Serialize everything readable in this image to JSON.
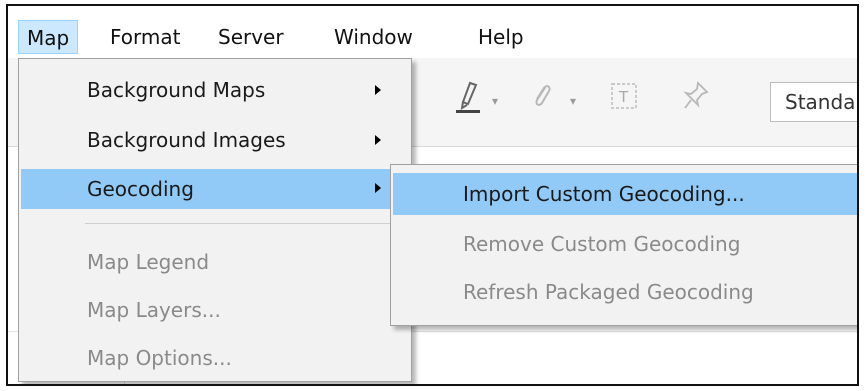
{
  "menubar": {
    "items": [
      "Map",
      "Format",
      "Server",
      "Window",
      "Help"
    ]
  },
  "toolbar": {
    "icons": [
      "highlighter-icon",
      "dropdown-caret-icon",
      "paperclip-icon",
      "dropdown-caret-icon",
      "text-box-icon",
      "pin-icon"
    ],
    "standard_label": "Standa"
  },
  "map_menu": {
    "items": [
      {
        "label": "Background Maps",
        "submenu": true,
        "enabled": true
      },
      {
        "label": "Background Images",
        "submenu": true,
        "enabled": true
      },
      {
        "label": "Geocoding",
        "submenu": true,
        "enabled": true,
        "highlighted": true
      },
      {
        "label": "Map Legend",
        "enabled": false
      },
      {
        "label": "Map Layers...",
        "enabled": false
      },
      {
        "label": "Map Options...",
        "enabled": false
      }
    ]
  },
  "geocoding_submenu": {
    "items": [
      {
        "label": "Import Custom Geocoding...",
        "enabled": true,
        "highlighted": true
      },
      {
        "label": "Remove Custom Geocoding",
        "enabled": false
      },
      {
        "label": "Refresh Packaged Geocoding",
        "enabled": false
      }
    ]
  },
  "colors": {
    "highlight": "#91c9f7",
    "menubar_active": "#cce8ff",
    "disabled_text": "#8a8a8a"
  }
}
